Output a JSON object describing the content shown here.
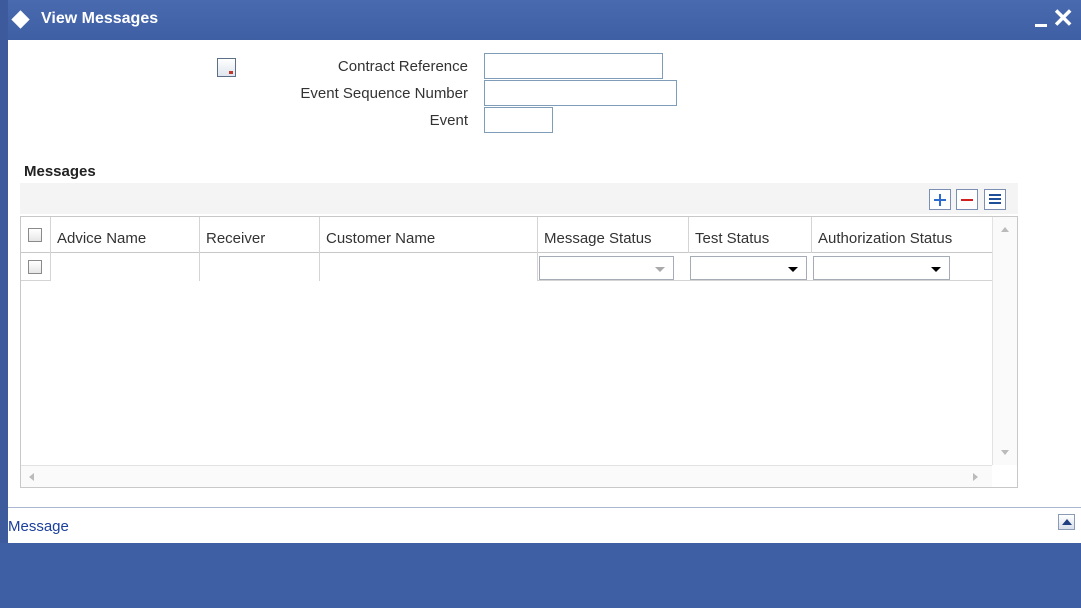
{
  "window": {
    "title": "View Messages"
  },
  "header": {
    "contract_reference_label": "Contract Reference",
    "contract_reference_value": "",
    "event_seq_label": "Event Sequence Number",
    "event_seq_value": "",
    "event_label": "Event",
    "event_value": ""
  },
  "messages": {
    "section_title": "Messages",
    "columns": [
      "Advice Name",
      "Receiver",
      "Customer Name",
      "Message Status",
      "Test Status",
      "Authorization Status"
    ],
    "rows": [
      {
        "advice_name": "",
        "receiver": "",
        "customer_name": "",
        "message_status": "",
        "test_status": "",
        "authorization_status": ""
      }
    ]
  },
  "footer": {
    "message_link": "Message"
  },
  "icons": {
    "title": "diamond-icon",
    "minimize": "minimize-icon",
    "close": "close-icon",
    "calendar": "calendar-icon",
    "add": "plus-icon",
    "delete": "minus-icon",
    "single_view": "list-icon",
    "expand": "chevron-up-icon"
  },
  "colors": {
    "titlebar": "#3f5fa4",
    "link": "#1a3f9c",
    "add": "#2e6bcf",
    "delete": "#d02020"
  }
}
